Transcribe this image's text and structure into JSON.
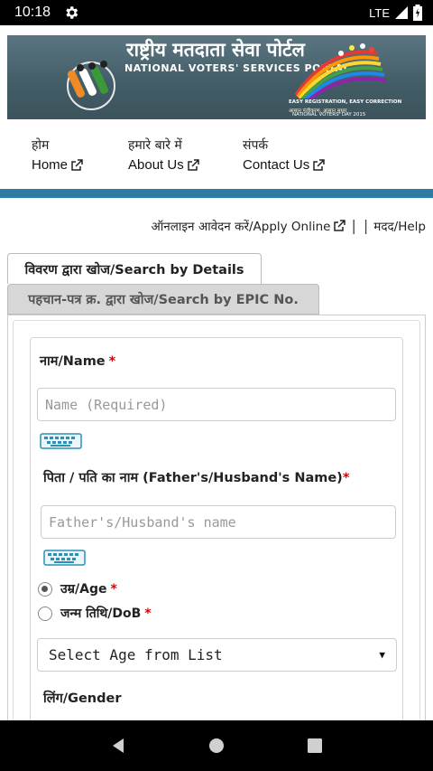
{
  "status_bar": {
    "time": "10:18",
    "network": "LTE"
  },
  "banner": {
    "hindi_title": "राष्ट्रीय मतदाता सेवा पोर्टल",
    "english_title": "NATIONAL VOTERS' SERVICES PORTAL",
    "tagline_1": "EASY REGISTRATION, EASY CORRECTION",
    "tagline_2": "आसान पंजीकरण, आसान सुधार",
    "tagline_3": "NATIONAL VOTERS' DAY 2015"
  },
  "nav": {
    "items": [
      {
        "hindi": "होम",
        "english": "Home"
      },
      {
        "hindi": "हमारे बारे में",
        "english": "About Us"
      },
      {
        "hindi": "संपर्क",
        "english": "Contact Us"
      }
    ]
  },
  "links": {
    "apply_online": "ऑनलाइन आवेदन करें/Apply Online",
    "separator": "|",
    "help": "मदद/Help"
  },
  "tabs": {
    "active": "विवरण द्वारा खोज/Search by Details",
    "inactive": "पहचान-पत्र क्र. द्वारा खोज/Search by EPIC No."
  },
  "form": {
    "name_label": "नाम/Name",
    "name_placeholder": "Name (Required)",
    "father_label": "पिता / पति का नाम (Father's/Husband's Name)",
    "father_placeholder": "Father's/Husband's name",
    "age_label": "उम्र/Age",
    "dob_label": "जन्म तिथि/DoB",
    "age_select_value": "Select Age from List",
    "gender_label": "लिंग/Gender",
    "required_mark": "*"
  },
  "colors": {
    "accent_bar": "#2f7ca3",
    "required": "#dd0000",
    "banner_bg": "#4a6570"
  }
}
